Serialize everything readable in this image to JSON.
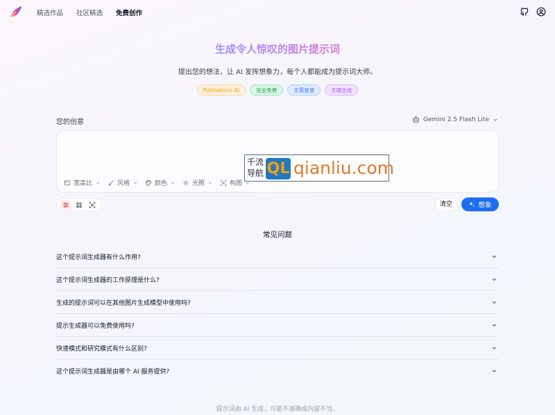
{
  "nav": {
    "links": [
      {
        "label": "精选作品",
        "active": false
      },
      {
        "label": "社区精选",
        "active": false
      },
      {
        "label": "免费创作",
        "active": true
      }
    ],
    "icons": [
      "github-icon",
      "user-icon"
    ]
  },
  "hero": {
    "title": "生成令人惊叹的图片提示词",
    "subtitle": "提出您的想法，让 AI 发挥想象力，每个人都能成为提示词大师。",
    "badges": [
      {
        "label": "Pollinations AI",
        "color": "#f59e0b",
        "bg": "#fdf0dc"
      },
      {
        "label": "完全免费",
        "color": "#16a34a",
        "bg": "#dcf5e6"
      },
      {
        "label": "无需登录",
        "color": "#3b82f6",
        "bg": "#e0ebfd"
      },
      {
        "label": "无限生成",
        "color": "#a855f7",
        "bg": "#efe3fb"
      }
    ]
  },
  "input": {
    "label": "您的创意",
    "model": "Gemini 2.5 Flash Lite",
    "placeholder": "",
    "options": [
      {
        "label": "宽高比",
        "icon": "aspect-ratio-icon"
      },
      {
        "label": "风格",
        "icon": "brush-icon"
      },
      {
        "label": "颜色",
        "icon": "palette-icon"
      },
      {
        "label": "光照",
        "icon": "sun-icon"
      },
      {
        "label": "构图",
        "icon": "frame-icon"
      }
    ],
    "clear_label": "清空",
    "submit_label": "想象"
  },
  "watermark": {
    "line1": "千流",
    "line2": "导航",
    "box": "QL",
    "domain": "qianliu.com"
  },
  "faq": {
    "title": "常见问题",
    "items": [
      "这个提示词生成器有什么作用?",
      "这个提示词生成器的工作原理是什么?",
      "生成的提示词可以在其他图片生成模型中使用吗?",
      "提示生成器可以免费使用吗?",
      "快速模式和研究模式有什么区别?",
      "这个提示词生成器是由哪个 AI 服务提供?"
    ]
  },
  "footer": {
    "note": "提示词由 AI 生成，可能不准确或内容不当。"
  },
  "colors": {
    "accent": "#1d6ff2"
  }
}
